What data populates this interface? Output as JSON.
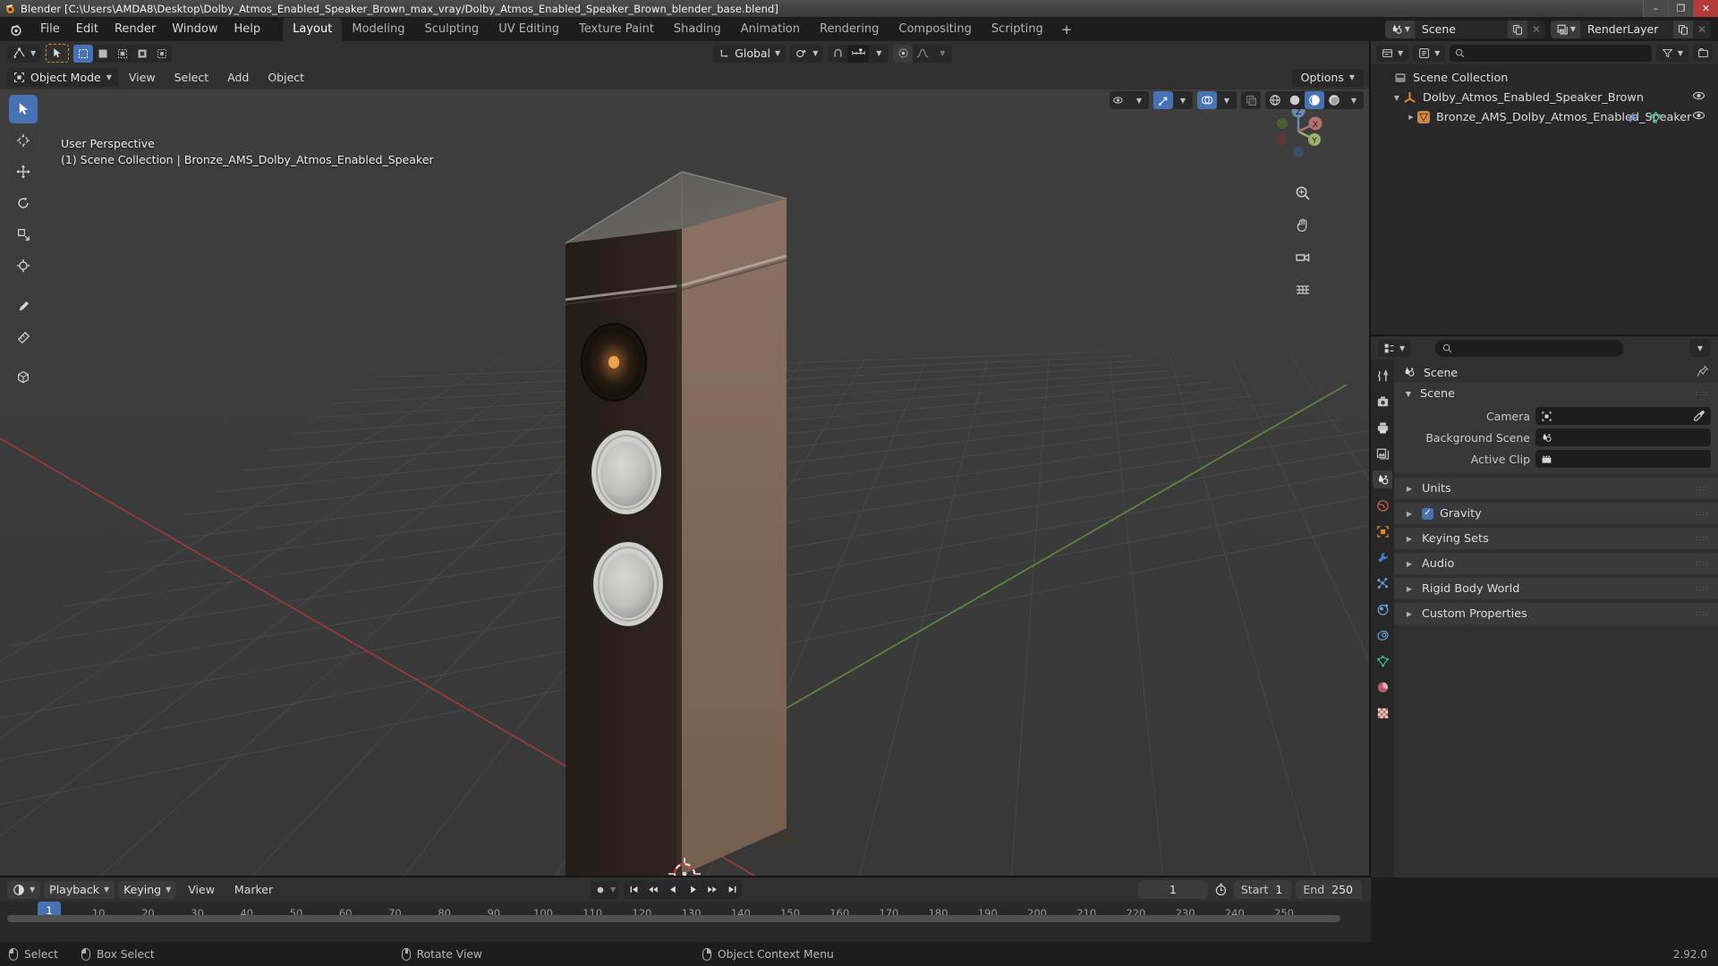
{
  "window": {
    "title": "Blender [C:\\Users\\AMDA8\\Desktop\\Dolby_Atmos_Enabled_Speaker_Brown_max_vray/Dolby_Atmos_Enabled_Speaker_Brown_blender_base.blend]",
    "minimize": "–",
    "maximize": "❐",
    "close": "✕"
  },
  "menu": {
    "items": [
      "File",
      "Edit",
      "Render",
      "Window",
      "Help"
    ]
  },
  "workspace_tabs": [
    {
      "label": "Layout",
      "active": true
    },
    {
      "label": "Modeling",
      "active": false
    },
    {
      "label": "Sculpting",
      "active": false
    },
    {
      "label": "UV Editing",
      "active": false
    },
    {
      "label": "Texture Paint",
      "active": false
    },
    {
      "label": "Shading",
      "active": false
    },
    {
      "label": "Animation",
      "active": false
    },
    {
      "label": "Rendering",
      "active": false
    },
    {
      "label": "Compositing",
      "active": false
    },
    {
      "label": "Scripting",
      "active": false
    },
    {
      "label": "+",
      "active": false
    }
  ],
  "topbar_right": {
    "scene_name": "Scene",
    "view_layer_name": "RenderLayer"
  },
  "viewport": {
    "mode": "Object Mode",
    "menus": [
      "View",
      "Select",
      "Add",
      "Object"
    ],
    "transform_orientation": "Global",
    "options_label": "Options",
    "overlay_line1": "User Perspective",
    "overlay_line2": "(1) Scene Collection | Bronze_AMS_Dolby_Atmos_Enabled_Speaker",
    "gizmo_axes": {
      "x": "X",
      "y": "Y",
      "z": "Z"
    }
  },
  "outliner": {
    "search_placeholder": "",
    "rows": [
      {
        "label": "Scene Collection",
        "indent": 0,
        "icon": "collection-icon",
        "expand": "",
        "eye": false
      },
      {
        "label": "Dolby_Atmos_Enabled_Speaker_Brown",
        "indent": 1,
        "icon": "empty-axis-icon",
        "expand": "▼",
        "eye": true
      },
      {
        "label": "Bronze_AMS_Dolby_Atmos_Enabled_Speaker",
        "indent": 2,
        "icon": "mesh-icon",
        "expand": "▶",
        "eye": true
      }
    ]
  },
  "properties": {
    "search_placeholder": "",
    "breadcrumb": "Scene",
    "panels": [
      {
        "label": "Scene",
        "open": true
      },
      {
        "label": "Units",
        "open": false
      },
      {
        "label": "Gravity",
        "open": false,
        "checkbox": true
      },
      {
        "label": "Keying Sets",
        "open": false
      },
      {
        "label": "Audio",
        "open": false
      },
      {
        "label": "Rigid Body World",
        "open": false
      },
      {
        "label": "Custom Properties",
        "open": false
      }
    ],
    "scene_fields": [
      {
        "label": "Camera",
        "value": "",
        "icon": "camera-icon",
        "eyedropper": true
      },
      {
        "label": "Background Scene",
        "value": "",
        "icon": "scene-icon",
        "eyedropper": false
      },
      {
        "label": "Active Clip",
        "value": "",
        "icon": "clip-icon",
        "eyedropper": false
      }
    ],
    "tabs": [
      {
        "name": "tool-tab",
        "active": false
      },
      {
        "name": "render-tab",
        "active": false
      },
      {
        "name": "output-tab",
        "active": false
      },
      {
        "name": "view-layer-tab",
        "active": false
      },
      {
        "name": "scene-tab",
        "active": true
      },
      {
        "name": "world-tab",
        "active": false
      },
      {
        "name": "object-tab",
        "active": false
      },
      {
        "name": "modifier-tab",
        "active": false
      },
      {
        "name": "particles-tab",
        "active": false
      },
      {
        "name": "physics-tab",
        "active": false
      },
      {
        "name": "constraints-tab",
        "active": false
      },
      {
        "name": "data-tab",
        "active": false
      },
      {
        "name": "material-tab",
        "active": false
      },
      {
        "name": "texture-tab",
        "active": false
      }
    ]
  },
  "timeline": {
    "menus": [
      "Playback",
      "Keying",
      "View",
      "Marker"
    ],
    "current_frame": "1",
    "start_label": "Start",
    "start_value": "1",
    "end_label": "End",
    "end_value": "250",
    "ruler_ticks": [
      "10",
      "20",
      "30",
      "40",
      "50",
      "60",
      "70",
      "80",
      "90",
      "100",
      "110",
      "120",
      "130",
      "140",
      "150",
      "160",
      "170",
      "180",
      "190",
      "200",
      "210",
      "220",
      "230",
      "240",
      "250"
    ],
    "playhead_frame": "1"
  },
  "statusbar": {
    "items": [
      {
        "mouse": "left",
        "label": "Select"
      },
      {
        "mouse": "left-drag",
        "label": "Box Select"
      },
      {
        "mouse": "middle",
        "label": "Rotate View"
      },
      {
        "mouse": "right",
        "label": "Object Context Menu"
      }
    ],
    "version": "2.92.0"
  },
  "colors": {
    "accent_blue": "#4772b3",
    "accent_orange": "#e08a2b",
    "axis_x_red": "#9e3b3b",
    "axis_y_green": "#5a8a3a",
    "bg_viewport": "#3b3b3b",
    "panel_bg": "#303030",
    "outliner_bg": "#282828"
  }
}
